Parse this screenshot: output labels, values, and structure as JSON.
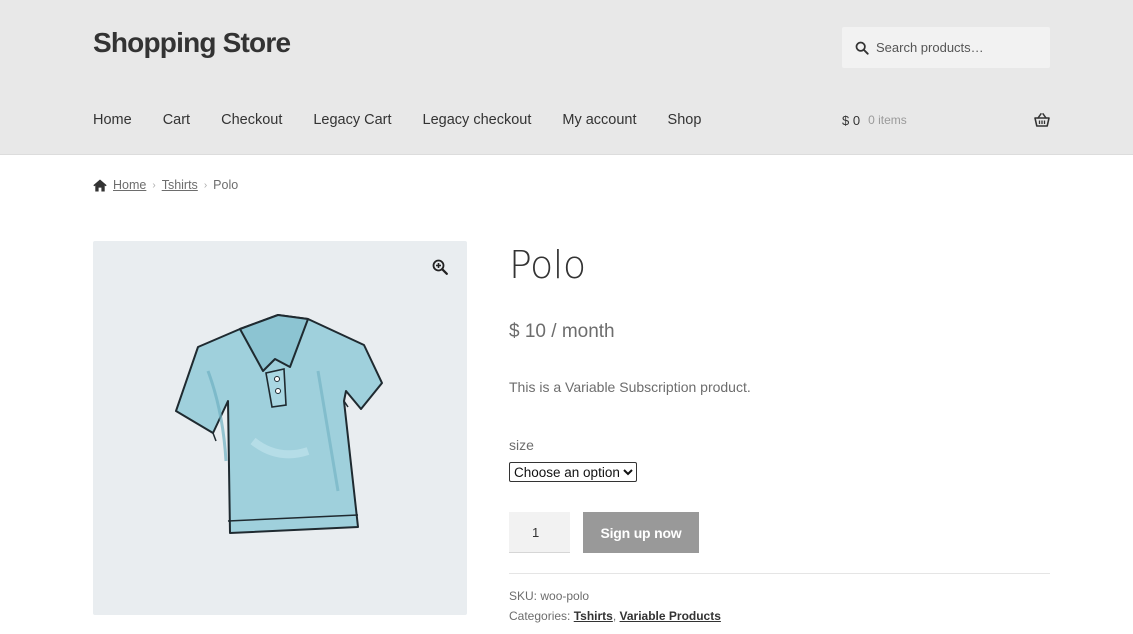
{
  "site": {
    "title": "Shopping Store"
  },
  "search": {
    "placeholder": "Search products…"
  },
  "nav": {
    "items": [
      {
        "label": "Home"
      },
      {
        "label": "Cart"
      },
      {
        "label": "Checkout"
      },
      {
        "label": "Legacy Cart"
      },
      {
        "label": "Legacy checkout"
      },
      {
        "label": "My account"
      },
      {
        "label": "Shop"
      }
    ]
  },
  "cart": {
    "amount": "$ 0",
    "count": "0 items",
    "icon": "basket-icon"
  },
  "breadcrumb": {
    "home": "Home",
    "category": "Tshirts",
    "current": "Polo",
    "separator": "›"
  },
  "product": {
    "title": "Polo",
    "price": "$ 10 / month",
    "description": "This is a Variable Subscription product.",
    "size_label": "size",
    "size_selected": "Choose an option",
    "quantity": "1",
    "button_label": "Sign up now",
    "sku_label": "SKU:",
    "sku_value": "woo-polo",
    "categories_label": "Categories:",
    "categories": [
      "Tshirts",
      "Variable Products"
    ],
    "categories_sep": ","
  },
  "colors": {
    "header_bg": "#e8e8e8",
    "button_bg": "#999999",
    "gallery_bg": "#e9edf0",
    "shirt": "#9fd0dc"
  }
}
